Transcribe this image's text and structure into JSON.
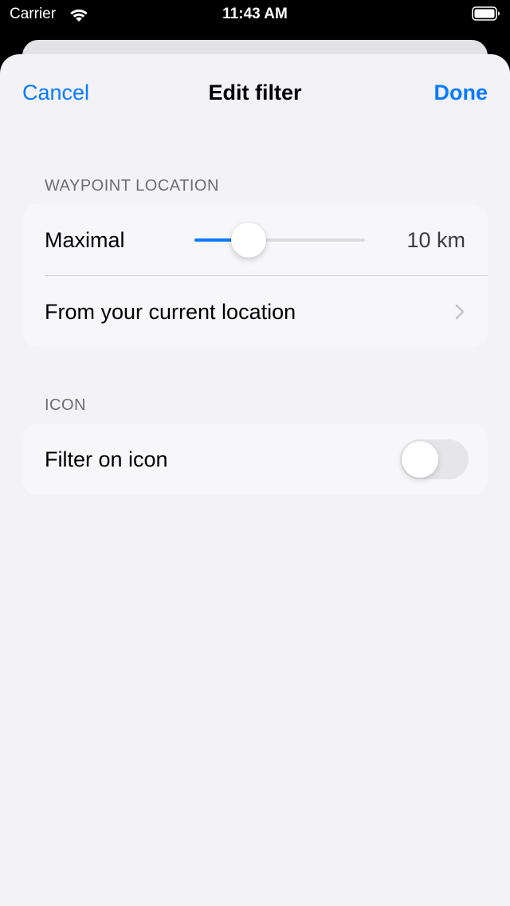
{
  "status_bar": {
    "carrier": "Carrier",
    "time": "11:43 AM",
    "wifi_icon": "wifi-icon",
    "battery_icon": "battery-full-icon"
  },
  "nav": {
    "cancel_label": "Cancel",
    "title": "Edit filter",
    "done_label": "Done"
  },
  "sections": {
    "waypoint": {
      "header": "WAYPOINT LOCATION",
      "distance_label": "Maximal",
      "distance_value": "10 km",
      "slider_fraction": 0.32,
      "from_location_label": "From your current location",
      "chevron_icon": "chevron-right-icon"
    },
    "icon": {
      "header": "ICON",
      "filter_label": "Filter on icon",
      "filter_enabled": false
    }
  },
  "colors": {
    "accent": "#0a7aff",
    "background": "#f2f2f7",
    "group_background": "#f7f7fa",
    "secondary_text": "#6d6d72"
  }
}
